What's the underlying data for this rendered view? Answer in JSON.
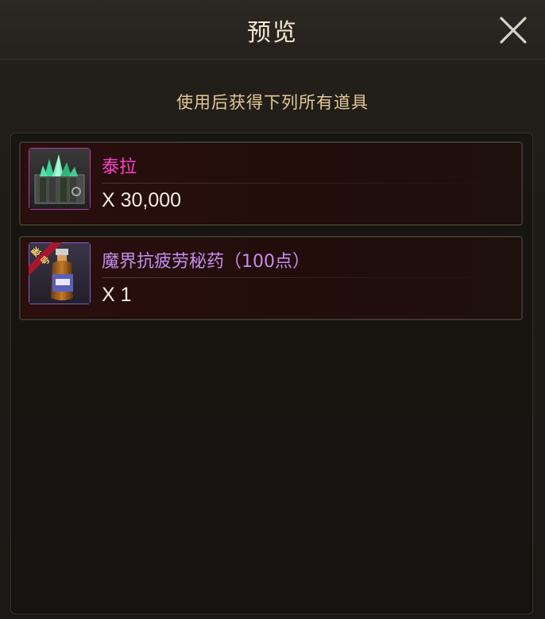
{
  "dialog": {
    "title": "预览",
    "subtitle": "使用后获得下列所有道具"
  },
  "items": [
    {
      "name": "泰拉",
      "quantity": "X 30,000",
      "name_color": "#ff43d0",
      "icon": "crystal-chest-icon"
    },
    {
      "name": "魔界抗疲劳秘药（100点）",
      "quantity": "X 1",
      "name_color": "#c48cf0",
      "icon": "potion-bottle-icon",
      "ribbon": "账号"
    }
  ],
  "colors": {
    "title": "#f2e6cf",
    "subtitle": "#e3c895",
    "item_bg": "#2a0f0d"
  }
}
